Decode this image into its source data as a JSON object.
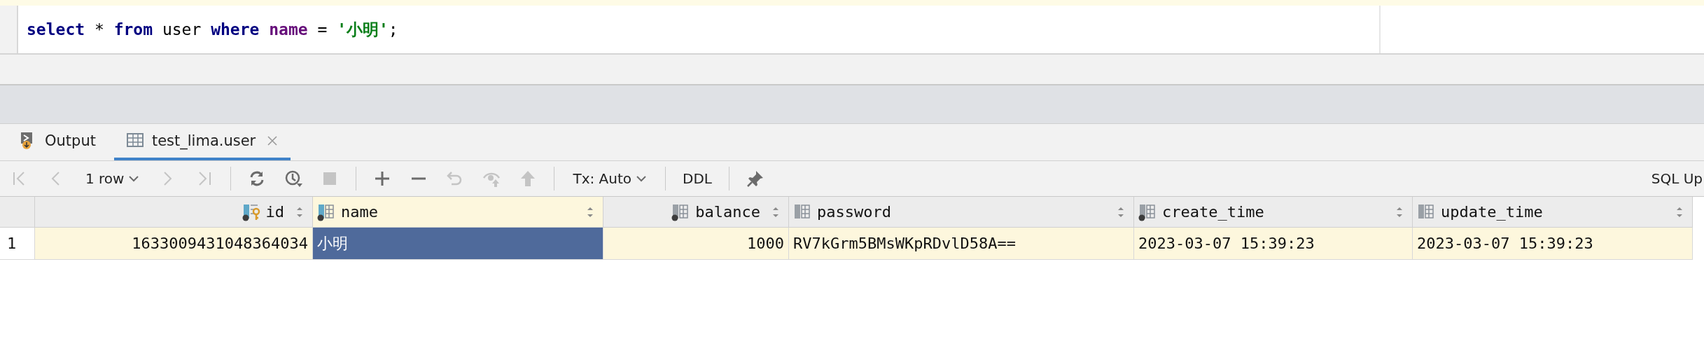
{
  "editor": {
    "lines": [
      {
        "tokens": [
          {
            "text": "select",
            "kind": "keyword"
          },
          {
            "text": " * ",
            "kind": "plain"
          },
          {
            "text": "from",
            "kind": "keyword"
          },
          {
            "text": " user ",
            "kind": "plain"
          },
          {
            "text": "where ",
            "kind": "keyword"
          },
          {
            "text": "name",
            "kind": "column"
          },
          {
            "text": " = ",
            "kind": "plain"
          },
          {
            "text": "'小明'",
            "kind": "string"
          },
          {
            "text": ";",
            "kind": "plain"
          }
        ]
      }
    ]
  },
  "tabs": [
    {
      "label": "Output",
      "kind": "output",
      "selected": false,
      "closable": false
    },
    {
      "label": "test_lima.user",
      "kind": "table",
      "selected": true,
      "closable": true
    }
  ],
  "toolbar": {
    "items": [
      {
        "kind": "first",
        "disabled": true
      },
      {
        "kind": "prev",
        "disabled": true
      },
      {
        "kind": "dropdown",
        "label": "1 row"
      },
      {
        "kind": "next",
        "disabled": true
      },
      {
        "kind": "last",
        "disabled": true
      },
      {
        "kind": "separator"
      },
      {
        "kind": "refresh",
        "disabled": false
      },
      {
        "kind": "history",
        "disabled": false
      },
      {
        "kind": "stop",
        "disabled": true
      },
      {
        "kind": "separator"
      },
      {
        "kind": "add",
        "disabled": false
      },
      {
        "kind": "remove",
        "disabled": false
      },
      {
        "kind": "revert",
        "disabled": true
      },
      {
        "kind": "preview",
        "disabled": true
      },
      {
        "kind": "submit",
        "disabled": true
      },
      {
        "kind": "separator"
      },
      {
        "kind": "dropdown",
        "label": "Tx: Auto"
      },
      {
        "kind": "separator"
      },
      {
        "kind": "text",
        "label": "DDL"
      },
      {
        "kind": "separator"
      },
      {
        "kind": "pin",
        "disabled": false
      }
    ],
    "right_label": "SQL Up"
  },
  "table": {
    "columns": [
      {
        "name": "id",
        "kind": "key",
        "tinted": true,
        "dot": true,
        "numeric": true,
        "current": false
      },
      {
        "name": "name",
        "kind": "column",
        "tinted": true,
        "dot": true,
        "numeric": false,
        "current": true
      },
      {
        "name": "balance",
        "kind": "column",
        "tinted": false,
        "dot": true,
        "numeric": true,
        "current": false
      },
      {
        "name": "password",
        "kind": "column",
        "tinted": false,
        "dot": false,
        "numeric": false,
        "current": false
      },
      {
        "name": "create_time",
        "kind": "column",
        "tinted": false,
        "dot": true,
        "numeric": false,
        "current": false
      },
      {
        "name": "update_time",
        "kind": "column",
        "tinted": false,
        "dot": false,
        "numeric": false,
        "current": false
      }
    ],
    "rows": [
      {
        "number": "1",
        "current": true,
        "cells": [
          {
            "text": "1633009431048364034",
            "selected": false
          },
          {
            "text": "小明",
            "selected": true
          },
          {
            "text": "1000",
            "selected": false
          },
          {
            "text": "RV7kGrm5BMsWKpRDvlD58A==",
            "selected": false
          },
          {
            "text": "2023-03-07 15:39:23",
            "selected": false
          },
          {
            "text": "2023-03-07 15:39:23",
            "selected": false
          }
        ]
      }
    ]
  }
}
